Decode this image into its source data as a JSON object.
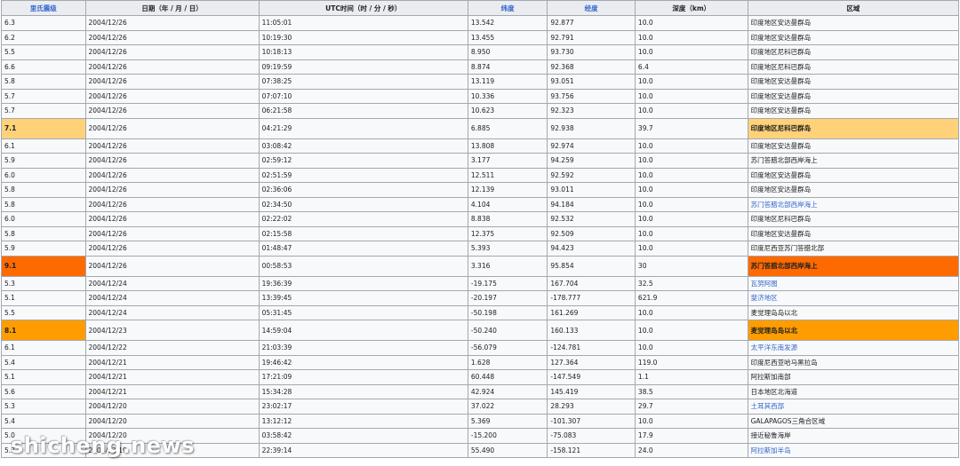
{
  "colors": {
    "m7": "#ffd27a",
    "m9": "#ff6a00",
    "m8": "#ff9d00",
    "link": "#3366cc",
    "header_bg": "#eaecf0"
  },
  "headers": [
    "里氏震级",
    "日期（年 / 月 / 日）",
    "UTC时间（时 / 分 / 秒）",
    "纬度",
    "经度",
    "深度（km）",
    "区域"
  ],
  "rows": [
    {
      "mag": "6.3",
      "date": "2004/12/26",
      "time": "11:05:01",
      "lat": "13.542",
      "lon": "92.877",
      "depth": "10.0",
      "region": "印度地区安达曼群岛"
    },
    {
      "mag": "6.2",
      "date": "2004/12/26",
      "time": "10:19:30",
      "lat": "13.455",
      "lon": "92.791",
      "depth": "10.0",
      "region": "印度地区安达曼群岛"
    },
    {
      "mag": "5.5",
      "date": "2004/12/26",
      "time": "10:18:13",
      "lat": "8.950",
      "lon": "93.730",
      "depth": "10.0",
      "region": "印度地区尼科巴群岛"
    },
    {
      "mag": "6.6",
      "date": "2004/12/26",
      "time": "09:19:59",
      "lat": "8.874",
      "lon": "92.368",
      "depth": "6.4",
      "region": "印度地区尼科巴群岛"
    },
    {
      "mag": "5.8",
      "date": "2004/12/26",
      "time": "07:38:25",
      "lat": "13.119",
      "lon": "93.051",
      "depth": "10.0",
      "region": "印度地区安达曼群岛"
    },
    {
      "mag": "5.7",
      "date": "2004/12/26",
      "time": "07:07:10",
      "lat": "10.336",
      "lon": "93.756",
      "depth": "10.0",
      "region": "印度地区安达曼群岛"
    },
    {
      "mag": "5.7",
      "date": "2004/12/26",
      "time": "06:21:58",
      "lat": "10.623",
      "lon": "92.323",
      "depth": "10.0",
      "region": "印度地区安达曼群岛"
    },
    {
      "mag": "7.1",
      "date": "2004/12/26",
      "time": "04:21:29",
      "lat": "6.885",
      "lon": "92.938",
      "depth": "39.7",
      "region": "印度地区尼科巴群岛",
      "hl": "m7"
    },
    {
      "mag": "6.1",
      "date": "2004/12/26",
      "time": "03:08:42",
      "lat": "13.808",
      "lon": "92.974",
      "depth": "10.0",
      "region": "印度地区安达曼群岛"
    },
    {
      "mag": "5.9",
      "date": "2004/12/26",
      "time": "02:59:12",
      "lat": "3.177",
      "lon": "94.259",
      "depth": "10.0",
      "region": "苏门答腊北部西岸海上"
    },
    {
      "mag": "6.0",
      "date": "2004/12/26",
      "time": "02:51:59",
      "lat": "12.511",
      "lon": "92.592",
      "depth": "10.0",
      "region": "印度地区安达曼群岛"
    },
    {
      "mag": "5.8",
      "date": "2004/12/26",
      "time": "02:36:06",
      "lat": "12.139",
      "lon": "93.011",
      "depth": "10.0",
      "region": "印度地区安达曼群岛"
    },
    {
      "mag": "5.8",
      "date": "2004/12/26",
      "time": "02:34:50",
      "lat": "4.104",
      "lon": "94.184",
      "depth": "10.0",
      "region": "苏门答腊北部西岸海上",
      "link": true
    },
    {
      "mag": "6.0",
      "date": "2004/12/26",
      "time": "02:22:02",
      "lat": "8.838",
      "lon": "92.532",
      "depth": "10.0",
      "region": "印度地区尼科巴群岛"
    },
    {
      "mag": "5.8",
      "date": "2004/12/26",
      "time": "02:15:58",
      "lat": "12.375",
      "lon": "92.509",
      "depth": "10.0",
      "region": "印度地区安达曼群岛"
    },
    {
      "mag": "5.9",
      "date": "2004/12/26",
      "time": "01:48:47",
      "lat": "5.393",
      "lon": "94.423",
      "depth": "10.0",
      "region": "印度尼西亚苏门答腊北部"
    },
    {
      "mag": "9.1",
      "date": "2004/12/26",
      "time": "00:58:53",
      "lat": "3.316",
      "lon": "95.854",
      "depth": "30",
      "region": "苏门答腊北部西岸海上",
      "hl": "m9"
    },
    {
      "mag": "5.3",
      "date": "2004/12/24",
      "time": "19:36:39",
      "lat": "-19.175",
      "lon": "167.704",
      "depth": "32.5",
      "region": "瓦努阿图",
      "link": true
    },
    {
      "mag": "5.1",
      "date": "2004/12/24",
      "time": "13:39:45",
      "lat": "-20.197",
      "lon": "-178.777",
      "depth": "621.9",
      "region": "斐济地区",
      "link": true
    },
    {
      "mag": "5.5",
      "date": "2004/12/24",
      "time": "05:31:45",
      "lat": "-50.198",
      "lon": "161.269",
      "depth": "10.0",
      "region": "麦觉理岛岛以北"
    },
    {
      "mag": "8.1",
      "date": "2004/12/23",
      "time": "14:59:04",
      "lat": "-50.240",
      "lon": "160.133",
      "depth": "10.0",
      "region": "麦觉理岛岛以北",
      "hl": "m8"
    },
    {
      "mag": "6.1",
      "date": "2004/12/22",
      "time": "21:03:39",
      "lat": "-56.079",
      "lon": "-124.781",
      "depth": "10.0",
      "region": "太平洋东南发源",
      "link": true
    },
    {
      "mag": "5.4",
      "date": "2004/12/21",
      "time": "19:46:42",
      "lat": "1.628",
      "lon": "127.364",
      "depth": "119.0",
      "region": "印度尼西亚哈马黑拉岛"
    },
    {
      "mag": "5.1",
      "date": "2004/12/21",
      "time": "17:21:09",
      "lat": "60.448",
      "lon": "-147.549",
      "depth": "1.1",
      "region": "阿拉斯加南部"
    },
    {
      "mag": "5.6",
      "date": "2004/12/21",
      "time": "15:34:28",
      "lat": "42.924",
      "lon": "145.419",
      "depth": "38.5",
      "region": "日本地区北海道"
    },
    {
      "mag": "5.3",
      "date": "2004/12/20",
      "time": "23:02:17",
      "lat": "37.022",
      "lon": "28.293",
      "depth": "29.7",
      "region": "土耳其西部",
      "link": true
    },
    {
      "mag": "5.4",
      "date": "2004/12/20",
      "time": "13:12:12",
      "lat": "5.369",
      "lon": "-101.307",
      "depth": "10.0",
      "region": "GALAPAGOS三角合区域"
    },
    {
      "mag": "5.0",
      "date": "2004/12/20",
      "time": "03:58:42",
      "lat": "-15.200",
      "lon": "-75.083",
      "depth": "17.9",
      "region": "接近秘鲁海岸"
    },
    {
      "mag": "5.3",
      "date": "2004/12/19",
      "time": "22:39:14",
      "lat": "55.490",
      "lon": "-158.121",
      "depth": "24.0",
      "region": "阿拉斯加半岛",
      "link": true
    }
  ],
  "watermark": "shicheng.news"
}
